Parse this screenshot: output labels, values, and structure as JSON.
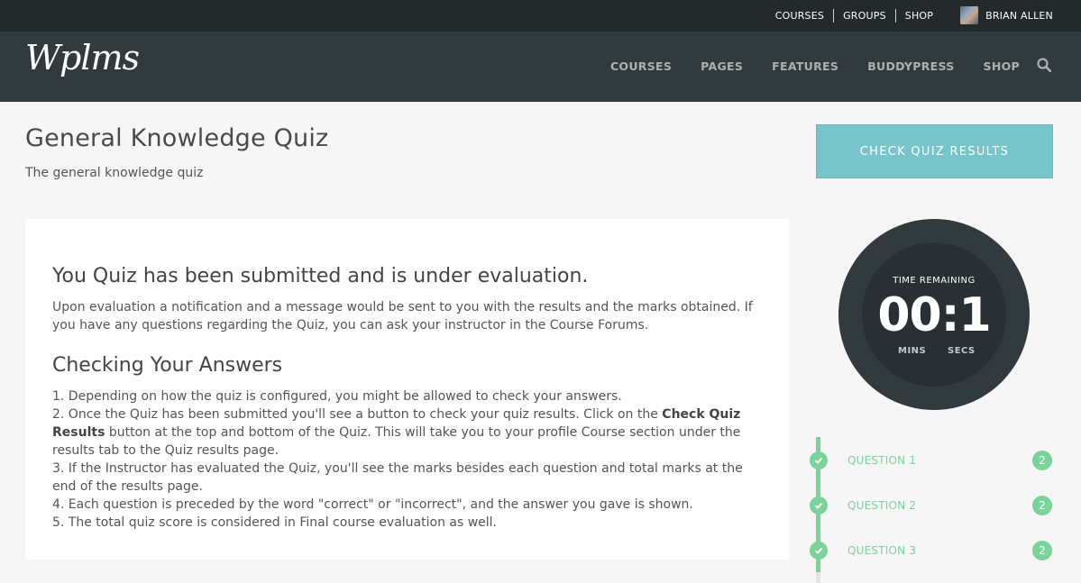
{
  "topbar": {
    "links": [
      "COURSES",
      "GROUPS",
      "SHOP"
    ],
    "user_name": "BRIAN ALLEN"
  },
  "header": {
    "logo": "Wplms",
    "nav": [
      "COURSES",
      "PAGES",
      "FEATURES",
      "BUDDYPRESS",
      "SHOP"
    ],
    "search_icon": "search-icon"
  },
  "page": {
    "title": "General Knowledge Quiz",
    "subtitle": "The general knowledge quiz"
  },
  "content": {
    "submitted_heading": "You Quiz has been submitted and is under evaluation.",
    "submitted_text": "Upon evaluation a notification and a message would be sent to you with the results and the marks obtained. If you have any questions regarding the Quiz, you can ask your instructor in the Course Forums.",
    "check_heading": "Checking Your Answers",
    "steps": {
      "s1": "1. Depending on how the quiz is configured, you might be allowed to check your answers.",
      "s2_pre": "2. Once the Quiz has been submitted you'll see a button to check your quiz results. Click on the ",
      "s2_bold": "Check Quiz Results",
      "s2_post": " button at the top and bottom of the Quiz. This will take you to your profile Course section under the results tab to the Quiz results page.",
      "s3": "3. If the Instructor has evaluated the Quiz, you'll see the marks besides each question and total marks at the end of the results page.",
      "s4": "4. Each question is preceded by the word \"correct\" or \"incorrect\", and the answer you gave is shown.",
      "s5": "5. The total quiz score is considered in Final course evaluation as well."
    }
  },
  "sidebar": {
    "results_button": "CHECK QUIZ RESULTS",
    "timer": {
      "label": "TIME REMAINING",
      "value": "00:1",
      "mins_label": "MINS",
      "secs_label": "SECS"
    },
    "questions": [
      {
        "label": "QUESTION 1",
        "marks": "2"
      },
      {
        "label": "QUESTION 2",
        "marks": "2"
      },
      {
        "label": "QUESTION 3",
        "marks": "2"
      }
    ],
    "accent_color": "#7bd39a",
    "button_color": "#78c4cb"
  }
}
